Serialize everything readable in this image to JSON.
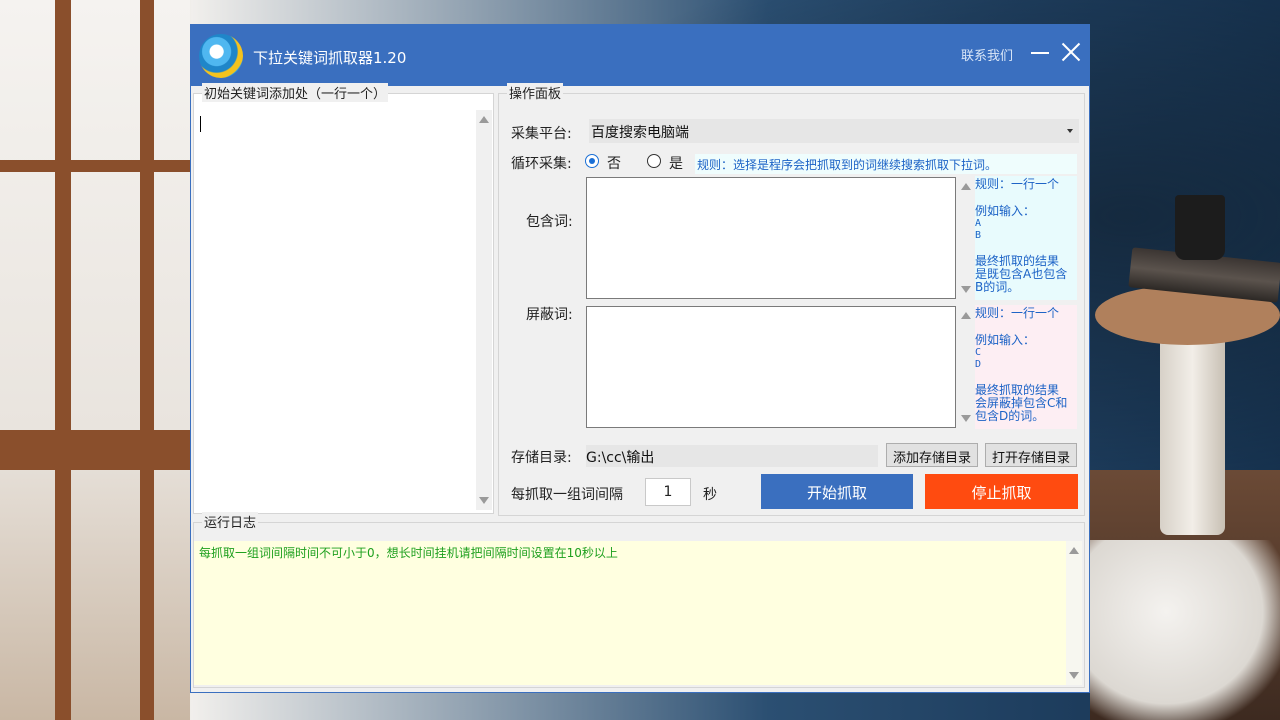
{
  "window": {
    "title": "下拉关键词抓取器1.20",
    "contact_label": "联系我们",
    "accent_color": "#3a6fbf"
  },
  "keywords_panel": {
    "legend": "初始关键词添加处（一行一个）",
    "value": ""
  },
  "operation_panel": {
    "legend": "操作面板",
    "platform_label": "采集平台:",
    "platform_value": "百度搜索电脑端",
    "loop_label": "循环采集:",
    "loop_options": [
      {
        "label": "否",
        "selected": true
      },
      {
        "label": "是",
        "selected": false
      }
    ],
    "loop_rule": "规则：选择是程序会把抓取到的词继续搜索抓取下拉词。",
    "include_label": "包含词:",
    "include_hint": {
      "line1": "规则：一行一个",
      "line2": "例如输入：",
      "ex1": "A",
      "ex2": "B",
      "result1": "最终抓取的结果",
      "result2": "是既包含A也包含",
      "result3": "B的词。"
    },
    "exclude_label": "屏蔽词:",
    "exclude_hint": {
      "line1": "规则：一行一个",
      "line2": "例如输入：",
      "ex1": "C",
      "ex2": "D",
      "result1": "最终抓取的结果",
      "result2": "会屏蔽掉包含C和",
      "result3": "包含D的词。"
    },
    "save_dir_label": "存储目录:",
    "save_dir_value": "G:\\cc\\输出",
    "add_dir_button": "添加存储目录",
    "open_dir_button": "打开存储目录",
    "interval_label": "每抓取一组词间隔",
    "interval_value": "1",
    "interval_unit": "秒",
    "start_button": "开始抓取",
    "stop_button": "停止抓取",
    "start_color": "#3a6fbf",
    "stop_color": "#ff4b10"
  },
  "log_panel": {
    "legend": "运行日志",
    "message": "每抓取一组词间隔时间不可小于0，想长时间挂机请把间隔时间设置在10秒以上"
  }
}
